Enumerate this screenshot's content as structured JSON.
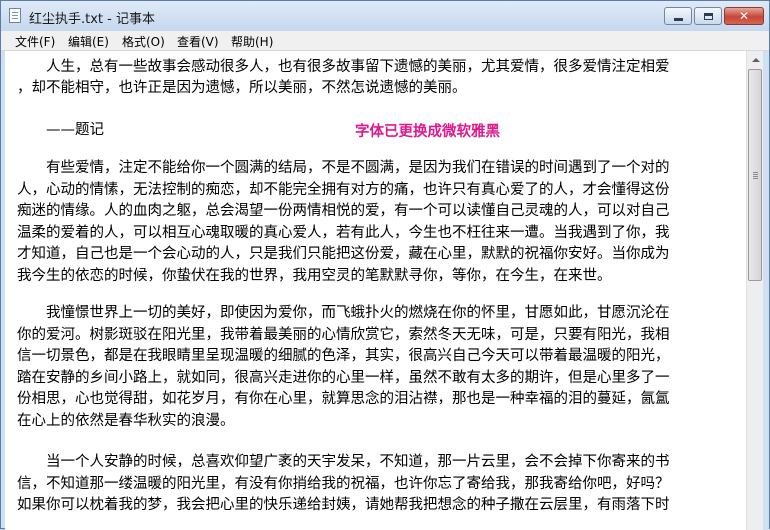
{
  "window": {
    "title": "红尘执手.txt - 记事本",
    "close_glyph": "✕"
  },
  "menu": {
    "items": [
      "文件(F)",
      "编辑(E)",
      "格式(O)",
      "查看(V)",
      "帮助(H)"
    ]
  },
  "overlay_note": "字体已更换成微软雅黑",
  "document": {
    "paragraphs": [
      [
        "　　人生，总有一些故事会感动很多人，也有很多故事留下遗憾的美丽，尤其爱情，很多爱情注定相爱",
        "，却不能相守，也许正是因为遗憾，所以美丽，不然怎说遗憾的美丽。"
      ],
      [
        "　　——题记"
      ],
      [
        "　　有些爱情，注定不能给你一个圆满的结局，不是不圆满，是因为我们在错误的时间遇到了一个对的",
        "人，心动的情愫，无法控制的痴恋，却不能完全拥有对方的痛，也许只有真心爱了的人，才会懂得这份",
        "痴迷的情缘。人的血肉之躯，总会渴望一份两情相悦的爱，有一个可以读懂自己灵魂的人，可以对自己",
        "温柔的爱着的人，可以相互心魂取暖的真心爱人，若有此人，今生也不枉往来一遭。当我遇到了你，我",
        "才知道，自己也是一个会心动的人，只是我们只能把这份爱，藏在心里，默默的祝福你安好。当你成为",
        "我今生的依恋的时候，你蛰伏在我的世界，我用空灵的笔默默寻你，等你，在今生，在来世。"
      ],
      [
        "　　我憧憬世界上一切的美好，即使因为爱你，而飞蛾扑火的燃烧在你的怀里，甘愿如此，甘愿沉沦在",
        "你的爱河。树影斑驳在阳光里，我带着最美丽的心情欣赏它，索然冬天无味，可是，只要有阳光，我相",
        "信一切景色，都是在我眼睛里呈现温暖的细腻的色泽，其实，很高兴自己今天可以带着最温暖的阳光，",
        "踏在安静的乡间小路上，就如同，很高兴走进你的心里一样，虽然不敢有太多的期许，但是心里多了一",
        "份相思，心也觉得甜，如花岁月，有你在心里，就算思念的泪沾襟，那也是一种幸福的泪的蔓延，氤氲",
        "在心上的依然是春华秋实的浪漫。"
      ],
      [
        "　　当一个人安静的时候，总喜欢仰望广袤的天宇发呆，不知道，那一片云里，会不会掉下你寄来的书",
        "信，不知道那一缕温暖的阳光里，有没有你捎给我的祝福，也许你忘了寄给我，那我寄给你吧，好吗？",
        "如果你可以枕着我的梦，我会把心里的快乐递给封姨，请她帮我把想念的种子撒在云层里，有雨落下时"
      ]
    ]
  }
}
